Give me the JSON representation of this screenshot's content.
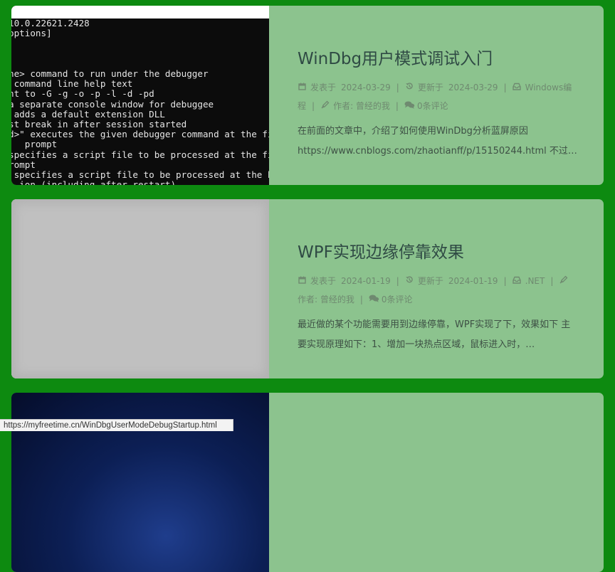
{
  "posts": [
    {
      "title": "WinDbg用户模式调试入门",
      "posted_label": "发表于",
      "posted_date": "2024-03-29",
      "updated_label": "更新于",
      "updated_date": "2024-03-29",
      "category_prefix": "Windows编",
      "category_suffix": "程",
      "author": "作者: 曾经的我",
      "comments": "0条评论",
      "excerpt": "在前面的文章中，介绍了如何使用WinDbg分析蓝屏原因 https://www.cnblogs.com/zhaotianff/p/15150244.html 不过…",
      "thumb_lines": [
        "10.0.22621.2428",
        "options]",
        "",
        "",
        "",
        "ne> command to run under the debugger",
        " command line help text",
        "nt to -G -g -o -p -l -d -pd",
        "a separate console window for debuggee",
        " adds a default extension DLL",
        "st break in after session started",
        "d>\" executes the given debugger command at the firs",
        "   prompt",
        "specifies a script file to be processed at the firs",
        "rompt",
        " specifies a script file to be processed at the beg",
        "  ion (including after restart)"
      ]
    },
    {
      "title": "WPF实现边缘停靠效果",
      "posted_label": "发表于",
      "posted_date": "2024-01-19",
      "updated_label": "更新于",
      "updated_date": "2024-01-19",
      "category": ".NET",
      "author": "作者: 曾经的我",
      "comments": "0条评论",
      "excerpt": "最近做的某个功能需要用到边缘停靠，WPF实现了下，效果如下  主要实现原理如下：1、增加一块热点区域，鼠标进入时，…"
    }
  ],
  "statusbar": {
    "url": "https://myfreetime.cn/WinDbgUserModeDebugStartup.html"
  },
  "icons": {
    "calendar": "calendar-icon",
    "history": "history-icon",
    "inbox": "inbox-icon",
    "pen": "pen-icon",
    "comments": "comments-icon"
  },
  "colors": {
    "background": "#0d8a10",
    "card": "#8cc38e",
    "meta": "#6f8a70",
    "title": "#2f4a44"
  }
}
